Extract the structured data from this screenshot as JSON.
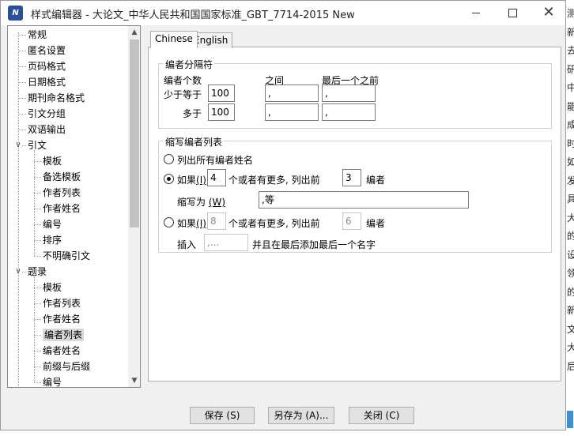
{
  "window": {
    "title": "样式编辑器 - 大论文_中华人民共和国国家标准_GBT_7714-2015 New",
    "icon_text": "N"
  },
  "tree": [
    {
      "label": "常规"
    },
    {
      "label": "匿名设置"
    },
    {
      "label": "页码格式"
    },
    {
      "label": "日期格式"
    },
    {
      "label": "期刊命名格式"
    },
    {
      "label": "引文分组"
    },
    {
      "label": "双语输出"
    },
    {
      "label": "引文",
      "expander": "∨"
    },
    {
      "label": "模板"
    },
    {
      "label": "备选模板"
    },
    {
      "label": "作者列表"
    },
    {
      "label": "作者姓名"
    },
    {
      "label": "编号"
    },
    {
      "label": "排序"
    },
    {
      "label": "不明确引文"
    },
    {
      "label": "题录",
      "expander": "∨"
    },
    {
      "label": "模板"
    },
    {
      "label": "作者列表"
    },
    {
      "label": "作者姓名"
    },
    {
      "label": "编者列表"
    },
    {
      "label": "编者姓名"
    },
    {
      "label": "前缀与后缀"
    },
    {
      "label": "编号"
    }
  ],
  "tabs": [
    "Chinese",
    "English"
  ],
  "separator_group": {
    "title": "编者分隔符",
    "col_count": "编者个数",
    "col_between": "之间",
    "col_last": "最后一个之前",
    "row1_label": "少于等于",
    "row1_count": "100",
    "row1_between": ",",
    "row1_last": ",",
    "row2_label": "多于",
    "row2_count": "100",
    "row2_between": ",",
    "row2_last": ","
  },
  "abbrev_group": {
    "title": "缩写编者列表",
    "opt_all": "列出所有编者姓名",
    "opt1_if": "如果",
    "opt1_key": "(I)",
    "opt1_count": "4",
    "opt1_mid": "个或者有更多, 列出前",
    "opt1_first": "3",
    "opt1_unit": "编者",
    "abbrev_label": "缩写为",
    "abbrev_key": "(W)",
    "abbrev_value": ",等",
    "opt2_if": "如果",
    "opt2_key": "(I)",
    "opt2_count": "8",
    "opt2_mid": "个或者有更多, 列出前",
    "opt2_first": "6",
    "opt2_unit": "编者",
    "insert_label": "插入",
    "insert_value": ",...",
    "insert_suffix": "并且在最后添加最后一个名字"
  },
  "buttons": {
    "save": "保存 (S)",
    "save_as": "另存为 (A)...",
    "close": "关闭 (C)"
  },
  "background_chars": [
    "测",
    "新",
    "去",
    "研",
    "中",
    "能",
    "成",
    "时",
    "如",
    "发",
    "具",
    "大",
    "的",
    "设",
    "领",
    "的",
    "新",
    "文",
    "大",
    "后"
  ]
}
